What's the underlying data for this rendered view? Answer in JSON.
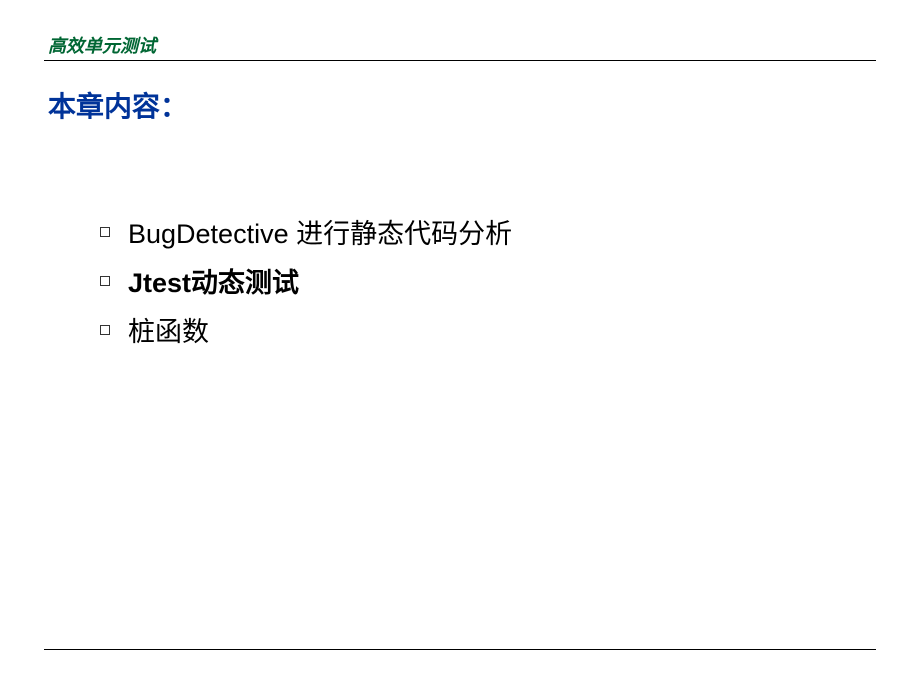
{
  "header": {
    "title": "高效单元测试"
  },
  "section": {
    "title": "本章内容："
  },
  "content": {
    "items": [
      {
        "text": "BugDetective 进行静态代码分析",
        "bold": false
      },
      {
        "text": "Jtest动态测试",
        "bold": true
      },
      {
        "text": "桩函数",
        "bold": false
      }
    ]
  }
}
